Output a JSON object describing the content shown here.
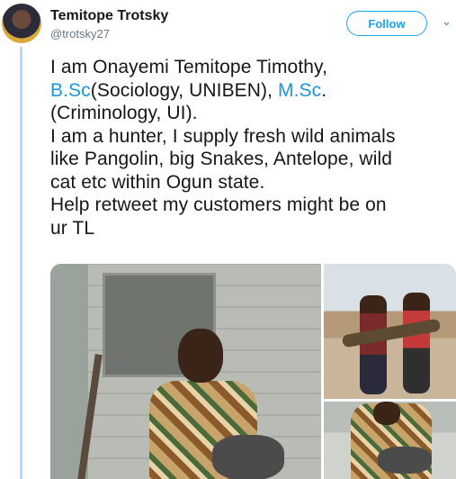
{
  "tweet": {
    "author": {
      "display_name": "Temitope Trotsky",
      "handle": "@trotsky27"
    },
    "follow_label": "Follow",
    "chevron": "⌄",
    "text": {
      "line1": "I am Onayemi Temitope Timothy,",
      "bsc_link": "B.Sc",
      "after_bsc": "(Sociology, UNIBEN), ",
      "msc_link": "M.Sc",
      "after_msc": ".",
      "line3": "(Criminology, UI).",
      "line4": "I am a hunter, I supply fresh wild animals",
      "line5": "like Pangolin, big Snakes, Antelope, wild",
      "line6": "cat etc within Ogun state.",
      "line7": "Help retweet my customers might be on",
      "line8": "ur TL"
    },
    "media_count": 3
  },
  "colors": {
    "link": "#1b95e0",
    "follow": "#1da1f2",
    "text": "#14171a",
    "muted": "#657786",
    "thread_line": "#c4d7e8"
  },
  "icons": {
    "avatar": "profile-avatar",
    "more": "chevron-down-icon"
  }
}
